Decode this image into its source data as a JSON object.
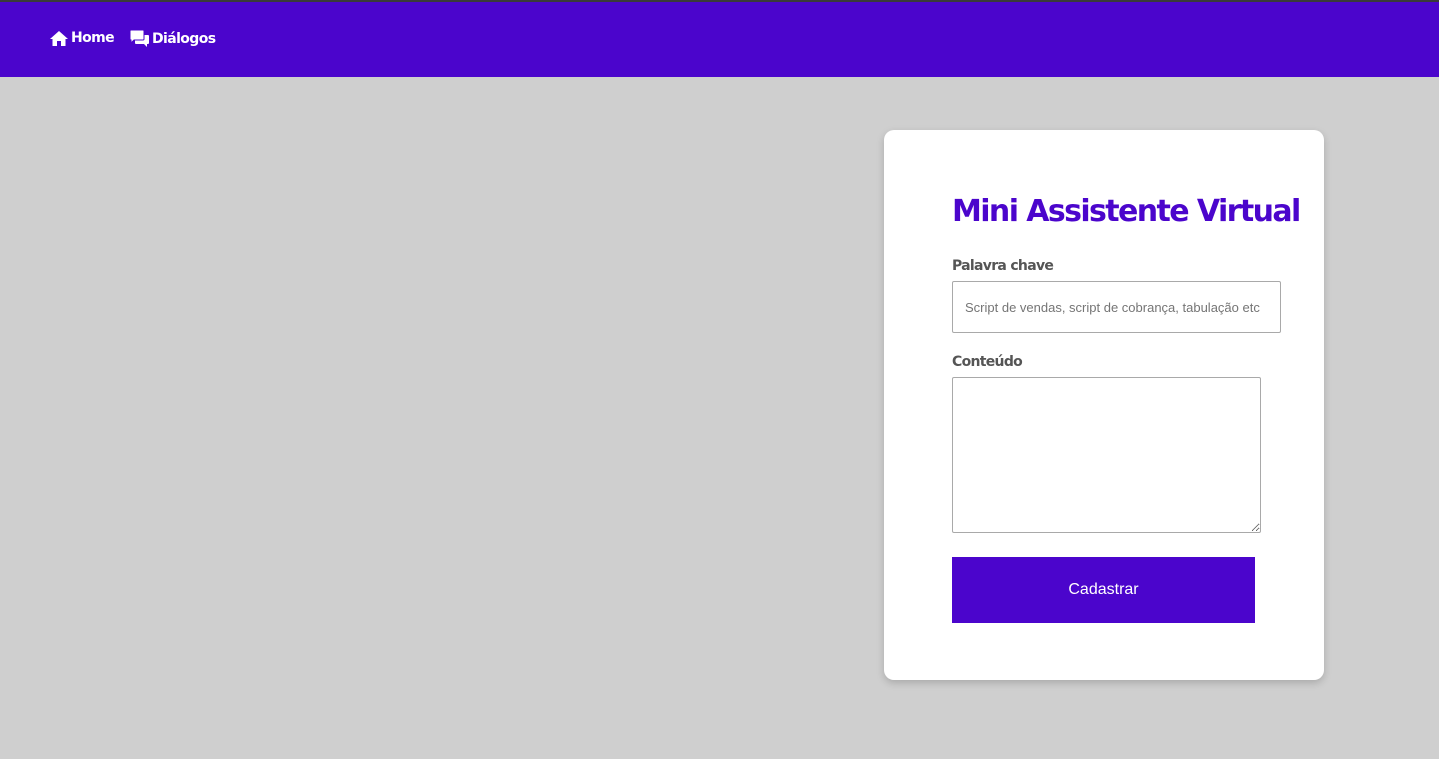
{
  "nav": {
    "home_label": "Home",
    "home_icon": "home-icon",
    "dialogs_label": "Diálogos",
    "dialogs_icon": "chat-bubbles-icon"
  },
  "form": {
    "title": "Mini Assistente Virtual",
    "keyword_label": "Palavra chave",
    "keyword_placeholder": "Script de vendas, script de cobrança, tabulação etc",
    "keyword_value": "",
    "content_label": "Conteúdo",
    "content_value": "",
    "submit_label": "Cadastrar"
  },
  "colors": {
    "brand": "#4b05cc",
    "background": "#cfcfcf",
    "card": "#ffffff"
  }
}
